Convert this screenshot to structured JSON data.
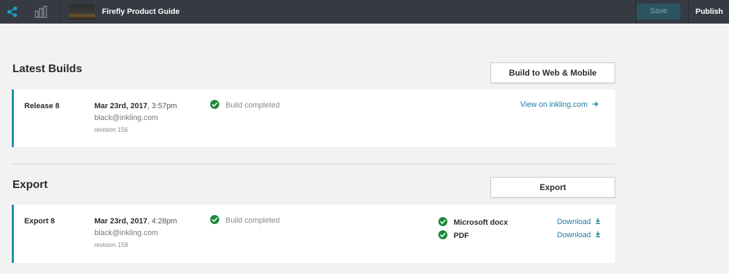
{
  "topbar": {
    "doc_title": "Firefly Product Guide",
    "save_label": "Save",
    "publish_label": "Publish",
    "icons": [
      "share-icon",
      "bar-chart-icon"
    ]
  },
  "builds": {
    "title": "Latest Builds",
    "action_label": "Build to Web & Mobile",
    "item": {
      "name": "Release 8",
      "date_bold": "Mar 23rd, 2017",
      "time": ", 3:57pm",
      "email": "black@inkling.com",
      "revision": "revision 156",
      "status": "Build completed",
      "link": "View on inkling.com"
    }
  },
  "export": {
    "title": "Export",
    "action_label": "Export",
    "item": {
      "name": "Export 8",
      "date_bold": "Mar 23rd, 2017",
      "time": ", 4:28pm",
      "email": "black@inkling.com",
      "revision": "revision 158",
      "status": "Build completed",
      "formats": [
        {
          "name": "Microsoft docx",
          "link": "Download"
        },
        {
          "name": "PDF",
          "link": "Download"
        }
      ]
    }
  },
  "colors": {
    "accent": "#1a8fae",
    "link": "#1a7fa0",
    "success": "#1d8a3a",
    "topbar": "#363a43"
  }
}
